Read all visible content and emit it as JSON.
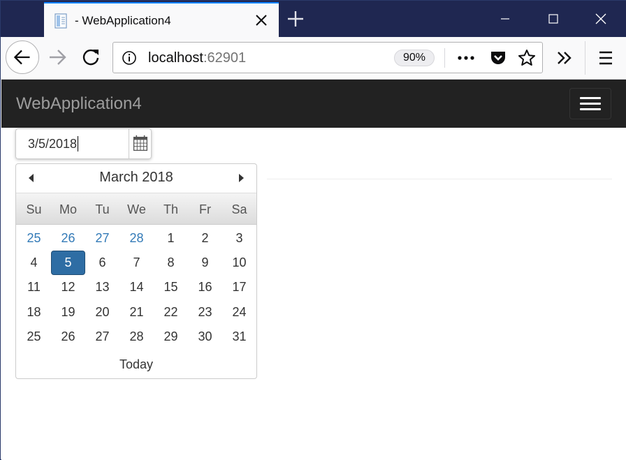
{
  "browser": {
    "tab_title": "- WebApplication4",
    "url_host": "localhost",
    "url_port": ":62901",
    "zoom": "90%"
  },
  "site": {
    "brand": "WebApplication4"
  },
  "date_input": {
    "value": "3/5/2018"
  },
  "datepicker": {
    "title": "March 2018",
    "weekdays": [
      "Su",
      "Mo",
      "Tu",
      "We",
      "Th",
      "Fr",
      "Sa"
    ],
    "weeks": [
      [
        "25",
        "26",
        "27",
        "28",
        "1",
        "2",
        "3"
      ],
      [
        "4",
        "5",
        "6",
        "7",
        "8",
        "9",
        "10"
      ],
      [
        "11",
        "12",
        "13",
        "14",
        "15",
        "16",
        "17"
      ],
      [
        "18",
        "19",
        "20",
        "21",
        "22",
        "23",
        "24"
      ],
      [
        "25",
        "26",
        "27",
        "28",
        "29",
        "30",
        "31"
      ]
    ],
    "selected": "5",
    "today_label": "Today"
  },
  "colors": {
    "accent": "#0a84ff",
    "selected_day": "#2e6da4",
    "other_month_day": "#337ab7",
    "site_navbar": "#222222"
  }
}
